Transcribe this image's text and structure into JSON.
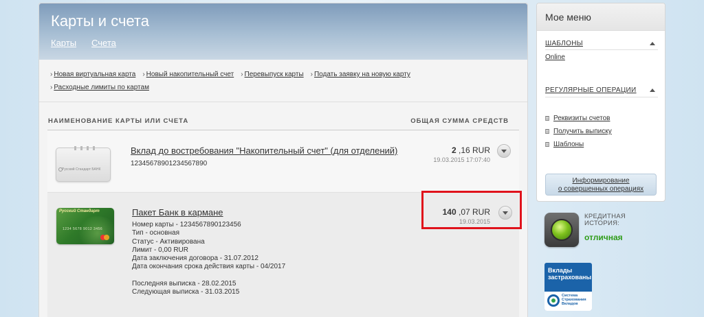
{
  "main": {
    "title": "Карты и счета",
    "tabs": [
      {
        "label": "Карты"
      },
      {
        "label": "Счета"
      }
    ],
    "actions": [
      {
        "label": "Новая виртуальная карта"
      },
      {
        "label": "Новый накопительный счет"
      },
      {
        "label": "Перевыпуск карты"
      },
      {
        "label": "Подать заявку на новую карту"
      },
      {
        "label": "Расходные лимиты по картам"
      }
    ],
    "columns": {
      "name": "НАИМЕНОВАНИЕ КАРТЫ ИЛИ СЧЕТА",
      "total": "ОБЩАЯ СУММА СРЕДСТВ"
    },
    "accounts": [
      {
        "name": "Вклад до востребования \"Накопительный счет\" (для отделений)",
        "number": "12345678901234567890",
        "amount_int": "2",
        "amount_frac": ",16 RUR",
        "date": "19.03.2015 17:07:40",
        "card_text": "Русский Стандарт БАНК",
        "icon": "deposit-card-grey"
      },
      {
        "name": "Пакет Банк в кармане",
        "amount_int": "140",
        "amount_frac": ",07 RUR",
        "date": "19.03.2015",
        "card_text": "Русский Стандарт",
        "card_number": "1234 5678 9012 3456",
        "icon": "bank-card-green",
        "details": [
          "Номер карты - 1234567890123456",
          "Тип - основная",
          "Статус - Активирована",
          "Лимит - 0,00 RUR",
          "Дата заключения договора - 31.07.2012",
          "Дата окончания срока действия карты - 04/2017"
        ],
        "statements": [
          "Последняя выписка - 28.02.2015",
          "Следующая выписка - 31.03.2015"
        ]
      }
    ]
  },
  "sidebar": {
    "title": "Мое меню",
    "templates": {
      "title": "ШАБЛОНЫ",
      "items": [
        {
          "label": "Online"
        }
      ]
    },
    "regular": {
      "title": "РЕГУЛЯРНЫЕ ОПЕРАЦИИ",
      "items": [
        {
          "label": "Реквизиты счетов"
        },
        {
          "label": "Получить выписку"
        },
        {
          "label": "Шаблоны"
        }
      ]
    },
    "info_button": {
      "line1": "Информирование",
      "line2": "о совершенных операциях"
    }
  },
  "credit": {
    "label_line1": "КРЕДИТНАЯ",
    "label_line2": "ИСТОРИЯ:",
    "status": "отличная",
    "status_color": "#2f9c19"
  },
  "insurance": {
    "title_line1": "Вклады",
    "title_line2": "застрахованы",
    "sub_line1": "Система",
    "sub_line2": "Страхования",
    "sub_line3": "Вкладов"
  },
  "colors": {
    "highlight": "#e0121b",
    "header": "#7f9cbb",
    "badge": "#1b63a9"
  }
}
